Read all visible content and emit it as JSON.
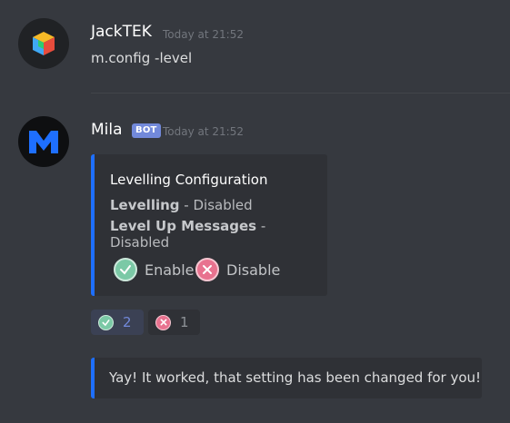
{
  "messages": [
    {
      "username": "JackTEK",
      "timestamp": "Today at 21:52",
      "content": "m.config -level"
    },
    {
      "username": "Mila",
      "badge": "BOT",
      "timestamp": "Today at 21:52",
      "embed": {
        "title": "Levelling Configuration",
        "fields": [
          {
            "name": "Levelling",
            "sep": " - ",
            "value": "Disabled"
          },
          {
            "name": "Level Up Messages",
            "sep": " - ",
            "value": "Disabled"
          }
        ],
        "options": [
          {
            "icon": "check-icon",
            "label": "Enable"
          },
          {
            "icon": "x-icon",
            "label": "Disable"
          }
        ],
        "accent_color": "#1e6fff"
      },
      "reactions": [
        {
          "icon": "check-icon",
          "count": "2",
          "reacted": true
        },
        {
          "icon": "x-icon",
          "count": "1",
          "reacted": false
        }
      ],
      "response_embed": {
        "text": "Yay! It worked, that setting has been changed for you!"
      }
    }
  ],
  "colors": {
    "background": "#36393f",
    "embed_background": "#2f3136",
    "bot_badge": "#7289da",
    "accent": "#1e6fff"
  }
}
